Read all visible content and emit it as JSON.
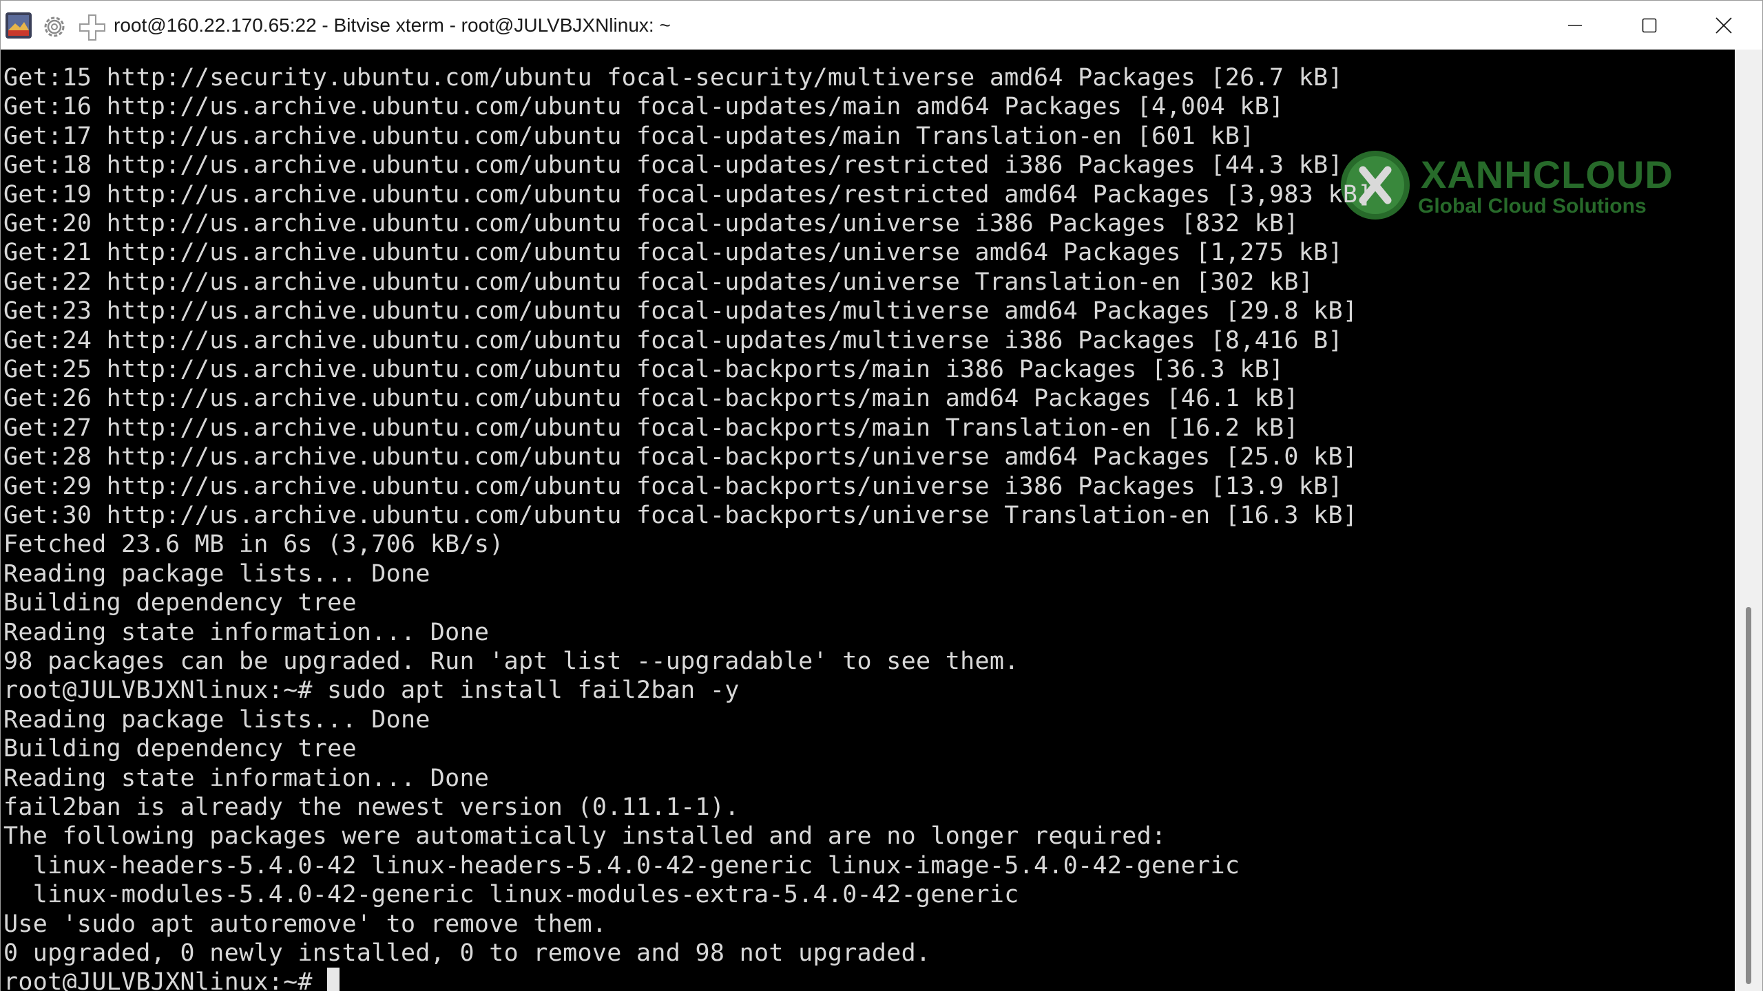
{
  "window": {
    "title": "root@160.22.170.65:22 - Bitvise xterm - root@JULVBJXNlinux: ~"
  },
  "watermark": {
    "brand": "XANHCLOUD",
    "tagline": "Global Cloud Solutions"
  },
  "terminal": {
    "lines": [
      "Get:15 http://security.ubuntu.com/ubuntu focal-security/multiverse amd64 Packages [26.7 kB]",
      "Get:16 http://us.archive.ubuntu.com/ubuntu focal-updates/main amd64 Packages [4,004 kB]",
      "Get:17 http://us.archive.ubuntu.com/ubuntu focal-updates/main Translation-en [601 kB]",
      "Get:18 http://us.archive.ubuntu.com/ubuntu focal-updates/restricted i386 Packages [44.3 kB]",
      "Get:19 http://us.archive.ubuntu.com/ubuntu focal-updates/restricted amd64 Packages [3,983 kB]",
      "Get:20 http://us.archive.ubuntu.com/ubuntu focal-updates/universe i386 Packages [832 kB]",
      "Get:21 http://us.archive.ubuntu.com/ubuntu focal-updates/universe amd64 Packages [1,275 kB]",
      "Get:22 http://us.archive.ubuntu.com/ubuntu focal-updates/universe Translation-en [302 kB]",
      "Get:23 http://us.archive.ubuntu.com/ubuntu focal-updates/multiverse amd64 Packages [29.8 kB]",
      "Get:24 http://us.archive.ubuntu.com/ubuntu focal-updates/multiverse i386 Packages [8,416 B]",
      "Get:25 http://us.archive.ubuntu.com/ubuntu focal-backports/main i386 Packages [36.3 kB]",
      "Get:26 http://us.archive.ubuntu.com/ubuntu focal-backports/main amd64 Packages [46.1 kB]",
      "Get:27 http://us.archive.ubuntu.com/ubuntu focal-backports/main Translation-en [16.2 kB]",
      "Get:28 http://us.archive.ubuntu.com/ubuntu focal-backports/universe amd64 Packages [25.0 kB]",
      "Get:29 http://us.archive.ubuntu.com/ubuntu focal-backports/universe i386 Packages [13.9 kB]",
      "Get:30 http://us.archive.ubuntu.com/ubuntu focal-backports/universe Translation-en [16.3 kB]",
      "Fetched 23.6 MB in 6s (3,706 kB/s)",
      "Reading package lists... Done",
      "Building dependency tree",
      "Reading state information... Done",
      "98 packages can be upgraded. Run 'apt list --upgradable' to see them.",
      "root@JULVBJXNlinux:~# sudo apt install fail2ban -y",
      "Reading package lists... Done",
      "Building dependency tree",
      "Reading state information... Done",
      "fail2ban is already the newest version (0.11.1-1).",
      "The following packages were automatically installed and are no longer required:",
      "  linux-headers-5.4.0-42 linux-headers-5.4.0-42-generic linux-image-5.4.0-42-generic",
      "  linux-modules-5.4.0-42-generic linux-modules-extra-5.4.0-42-generic",
      "Use 'sudo apt autoremove' to remove them.",
      "0 upgraded, 0 newly installed, 0 to remove and 98 not upgraded."
    ],
    "prompt": "root@JULVBJXNlinux:~# "
  },
  "colors": {
    "background": "#000000",
    "foreground": "#d8d8d8",
    "watermark": "#2e7d32"
  },
  "icons": [
    "bitvise-app-icon",
    "gear-icon",
    "new-terminal-icon",
    "minimize-icon",
    "maximize-icon",
    "close-icon"
  ]
}
